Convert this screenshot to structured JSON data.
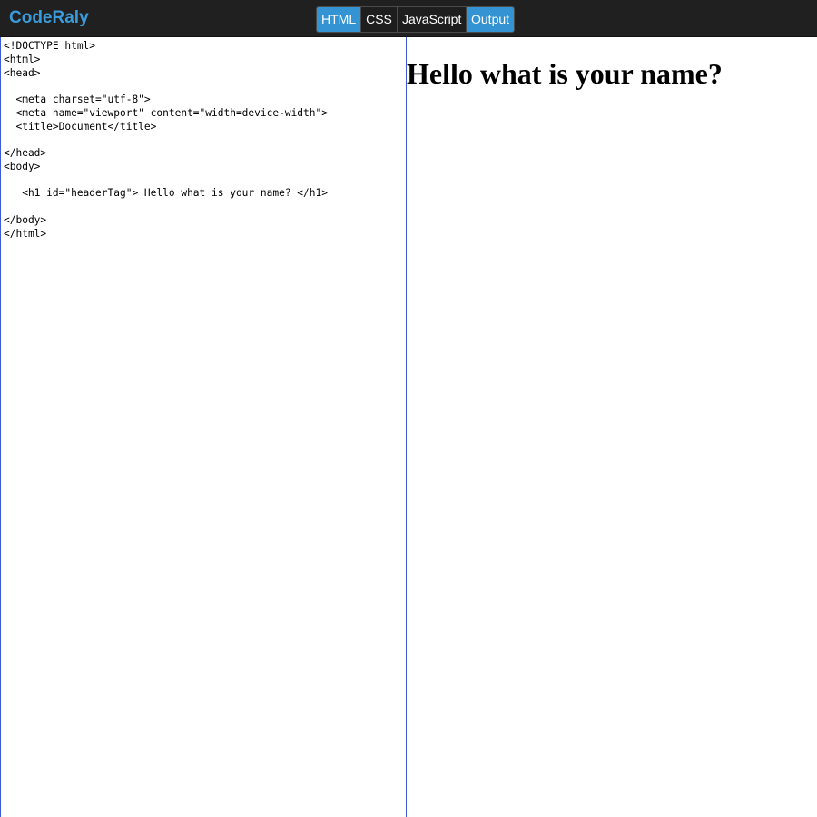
{
  "app": {
    "title": "CodeRaly",
    "colors": {
      "brand": "#3b9ad9",
      "active_tab": "#3393d3",
      "topbar": "#202020",
      "editor_border": "#3b5bd9"
    }
  },
  "tabs": [
    {
      "label": "HTML",
      "active": true
    },
    {
      "label": "CSS",
      "active": false
    },
    {
      "label": "JavaScript",
      "active": false
    },
    {
      "label": "Output",
      "active": true
    }
  ],
  "editor": {
    "lines": [
      "<!DOCTYPE html>",
      "<html>",
      "<head>",
      "",
      "  <meta charset=\"utf-8\">",
      "  <meta name=\"viewport\" content=\"width=device-width\">",
      "  <title>Document</title>",
      "",
      "</head>",
      "<body>",
      "",
      "   <h1 id=\"headerTag\"> Hello what is your name? </h1>",
      "",
      "</body>",
      "</html>"
    ]
  },
  "output": {
    "heading": "Hello what is your name?"
  }
}
